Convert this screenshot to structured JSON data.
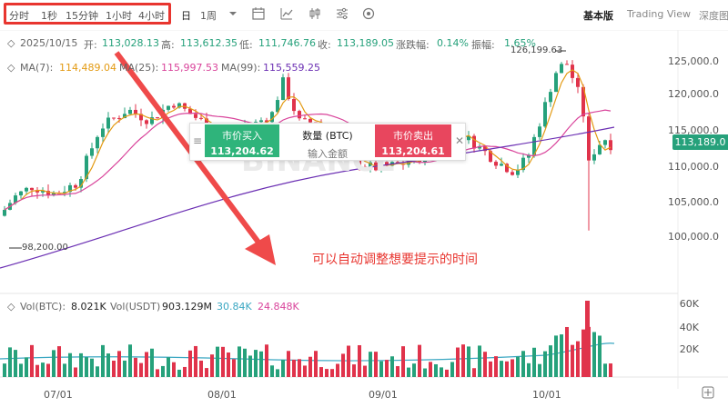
{
  "toolbar": {
    "intervals": [
      "分时",
      "1秒",
      "15分钟",
      "1小时",
      "4小时",
      "日",
      "1周"
    ],
    "views": [
      "基本版",
      "Trading View",
      "深度图"
    ]
  },
  "ohlc": {
    "date": "2025/10/15",
    "open_label": "开:",
    "open": "113,028.13",
    "high_label": "高:",
    "high": "113,612.35",
    "low_label": "低:",
    "low": "111,746.76",
    "close_label": "收:",
    "close": "113,189.05",
    "change_label": "涨跌幅:",
    "change": "0.14%",
    "amplitude_label": "振幅:",
    "amplitude": "1.65%"
  },
  "ma": {
    "ma7_label": "MA(7):",
    "ma7": "114,489.04",
    "ma25_label": "MA(25):",
    "ma25": "115,997.53",
    "ma99_label": "MA(99):",
    "ma99": "115,559.25"
  },
  "price_axis": [
    "125,000.0",
    "120,000.0",
    "115,000.0",
    "110,000.0",
    "105,000.0",
    "100,000.0"
  ],
  "current_price": "113,189.0",
  "high_marker": "126,199.63",
  "low_marker": "98,200.00",
  "trade_panel": {
    "buy_title": "市价买入",
    "buy_price": "113,204.62",
    "qty_title": "数量 (BTC)",
    "qty_placeholder": "输入金额",
    "sell_title": "市价卖出",
    "sell_price": "113,204.61"
  },
  "annotation": "可以自动调整想要提示的时间",
  "volume": {
    "vol_btc_label": "Vol(BTC):",
    "vol_btc": "8.021K",
    "vol_usdt_label": "Vol(USDT)",
    "vol_usdt": "903.129M",
    "ma1": "30.84K",
    "ma2": "24.848K",
    "axis": [
      "60K",
      "40K",
      "20K"
    ]
  },
  "dates": [
    "07/01",
    "08/01",
    "09/01",
    "10/01"
  ],
  "colors": {
    "up": "#26a17b",
    "down": "#e0334b",
    "ma7": "#e39a13",
    "ma25": "#d9449b",
    "ma99": "#6b2fb3",
    "highlight": "#e8352f"
  }
}
